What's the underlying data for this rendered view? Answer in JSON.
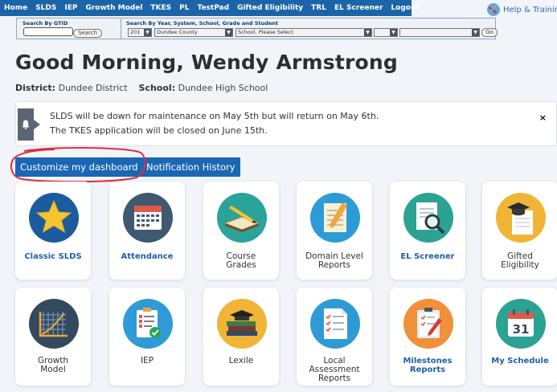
{
  "nav": {
    "items": [
      "Home",
      "SLDS",
      "IEP",
      "Growth Model",
      "TKES",
      "PL",
      "TestPad",
      "Gifted Eligibility",
      "TRL",
      "EL Screener",
      "Logout"
    ],
    "help_label": "Help & Training"
  },
  "search": {
    "gtid_label": "Search By GTID",
    "gtid_button": "Search",
    "ys_label": "Search By Year, System, School, Grade and Student",
    "year_value": "201",
    "system_value": "Dundee County",
    "school_value": "School, Please Select",
    "go_button": "Go"
  },
  "greeting": "Good Morning, Wendy Armstrong",
  "district": {
    "district_label": "District:",
    "district_value": "Dundee District",
    "school_label": "School:",
    "school_value": "Dundee High School"
  },
  "alert": {
    "line1": "SLDS will be down for maintenance on May 5th but will return on May 6th.",
    "line2": "The TKES application will be closed on June 15th.",
    "close": "×"
  },
  "buttons": {
    "customize": "Customize my dashboard",
    "notification_history": "Notification History"
  },
  "tiles_row1": [
    {
      "label": "Classic SLDS",
      "icon": "star-icon",
      "color": "#1a5c9e",
      "link": true
    },
    {
      "label": "Attendance",
      "icon": "calendar-icon",
      "color": "#3f5a70",
      "link": true
    },
    {
      "label": "Course\nGrades",
      "icon": "book-pencil-icon",
      "color": "#2aa39a",
      "link": false
    },
    {
      "label": "Domain Level\nReports",
      "icon": "notepad-pencil-icon",
      "color": "#2e9bd6",
      "link": false
    },
    {
      "label": "EL Screener",
      "icon": "magnifier-document-icon",
      "color": "#2ba292",
      "link": true
    },
    {
      "label": "Gifted\nEligibility",
      "icon": "graduation-cap-icon",
      "color": "#f0b436",
      "link": false
    }
  ],
  "tiles_row2": [
    {
      "label": "Growth\nModel",
      "icon": "growth-chart-icon",
      "color": "#33495e",
      "link": false
    },
    {
      "label": "IEP",
      "icon": "checklist-icon",
      "color": "#2e9bd6",
      "link": false
    },
    {
      "label": "Lexile",
      "icon": "books-icon",
      "color": "#f0b436",
      "link": false
    },
    {
      "label": "Local\nAssessment\nReports",
      "icon": "checklist-paper-icon",
      "color": "#2e9bd6",
      "link": false
    },
    {
      "label": "Milestones\nReports",
      "icon": "clipboard-pen-icon",
      "color": "#f0913a",
      "link": true
    },
    {
      "label": "My Schedule",
      "icon": "calendar-31-icon",
      "color": "#2ba292",
      "link": true
    }
  ]
}
